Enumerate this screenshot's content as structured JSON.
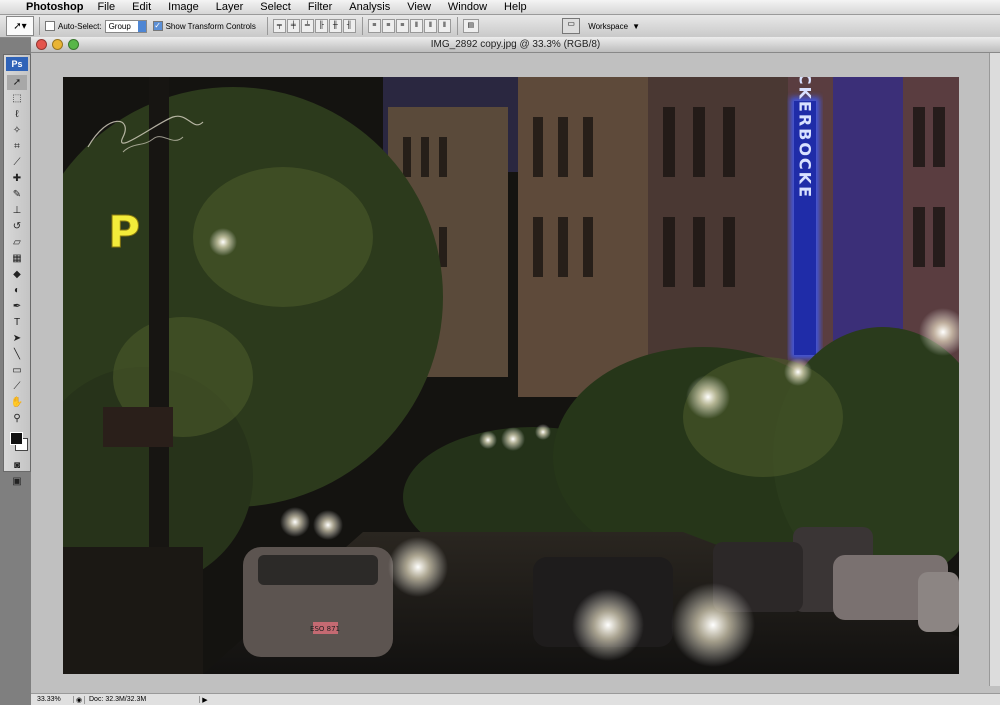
{
  "menubar": {
    "apple_icon": "apple-icon",
    "app_name": "Photoshop",
    "items": [
      "File",
      "Edit",
      "Image",
      "Layer",
      "Select",
      "Filter",
      "Analysis",
      "View",
      "Window",
      "Help"
    ]
  },
  "options_bar": {
    "auto_select_label": "Auto-Select:",
    "auto_select_value": "Group",
    "transform_label": "Show Transform Controls",
    "workspace_label": "Workspace"
  },
  "toolbox": {
    "badge": "Ps"
  },
  "document": {
    "title": "IMG_2892 copy.jpg @ 33.3% (RGB/8)",
    "status_zoom": "33.33%",
    "status_doc": "Doc: 32.3M/32.3M",
    "photo_sign": "P",
    "neon_sign": "KNICKERBOCKE",
    "plate": "ESO 871"
  },
  "colors": {
    "neon_blue": "#3d5bff",
    "neon_yellow": "#f3ec3a",
    "toolbox_badge": "#2f63b8"
  }
}
